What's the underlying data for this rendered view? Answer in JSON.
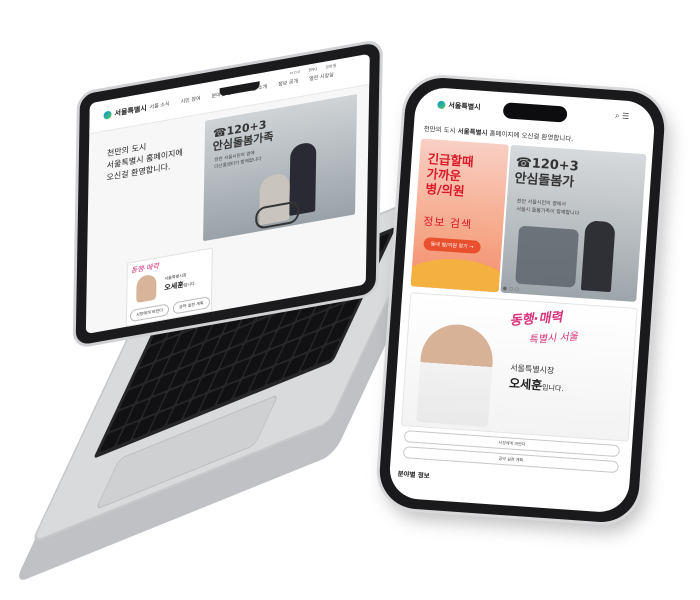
{
  "laptop": {
    "logo": "서울특별시",
    "nav": [
      "서울 소식",
      "시민 참여",
      "분야별 정보",
      "서울 소개",
      "정보 공개",
      "열린 시장실"
    ],
    "utility": [
      "ㅁㅁㅁ",
      "ENG",
      "모바일"
    ],
    "welcome": "천만의 도시\n서울특별시 홈페이지에\n오신걸 환영합니다.",
    "hero": {
      "title": "☎120+3\n안심돌봄가족",
      "subtitle": "천만 서울시민의 곁에\n다산콜센터가 함께합니다"
    },
    "mayor": {
      "slogan": "동행·매력",
      "title": "서울특별시장",
      "name": "오세훈",
      "suffix": "입니다.",
      "buttons": [
        "시장에게 바란다",
        "공약 실천 계획"
      ]
    }
  },
  "phone": {
    "logo": "서울특별시",
    "icons": "⌕ ☰",
    "welcome_prefix": "천만의 도시 ",
    "welcome_bold": "서울특별시",
    "welcome_suffix": " 홈페이지에 오신걸 환영합니다.",
    "banner1": {
      "title": "긴급할때\n가까운\n병/의원",
      "subtitle": "정보 검색",
      "button": "동네 병/의원 찾기 →"
    },
    "banner2": {
      "title": "☎120+3\n안심돌봄가",
      "subtitle": "천만 서울시민의 곁에서\n서울시 돌봄가족이 함께합니다"
    },
    "carousel_indicator": "● ○ ○",
    "mayor": {
      "slogan_line1": "동행·매력",
      "slogan_line2": "특별시 서울",
      "title": "서울특별시장",
      "name": "오세훈",
      "suffix": "입니다.",
      "buttons": [
        "시장에게 바란다",
        "공약 실천 계획"
      ]
    },
    "footer_heading": "분야별 정보"
  }
}
